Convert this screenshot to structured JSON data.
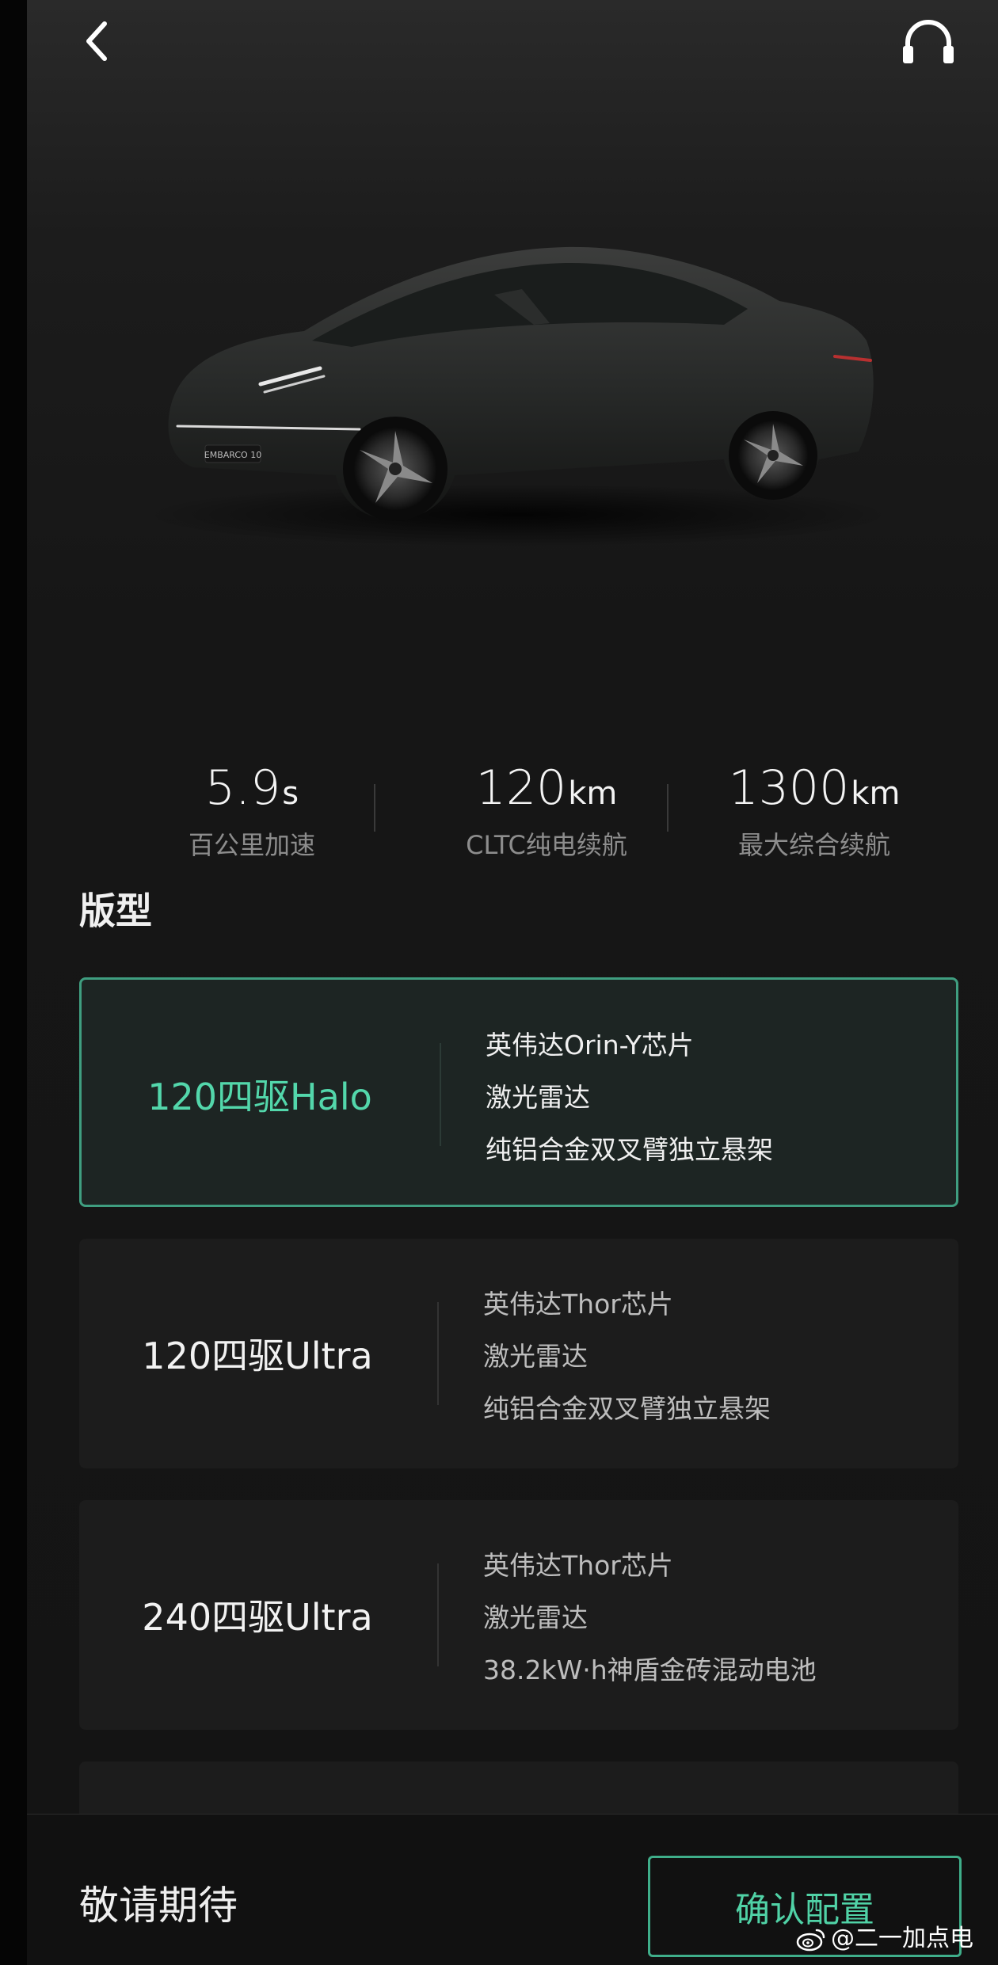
{
  "stats": [
    {
      "value": "5.9",
      "unit": "s",
      "label": "百公里加速"
    },
    {
      "value": "120",
      "unit": "km",
      "label": "CLTC纯电续航"
    },
    {
      "value": "1300",
      "unit": "km",
      "label": "最大综合续航"
    }
  ],
  "section_title": "版型",
  "trims": [
    {
      "name": "120四驱Halo",
      "selected": true,
      "features": [
        "英伟达Orin-Y芯片",
        "激光雷达",
        "纯铝合金双叉臂独立悬架"
      ]
    },
    {
      "name": "120四驱Ultra",
      "selected": false,
      "features": [
        "英伟达Thor芯片",
        "激光雷达",
        "纯铝合金双叉臂独立悬架"
      ]
    },
    {
      "name": "240四驱Ultra",
      "selected": false,
      "features": [
        "英伟达Thor芯片",
        "激光雷达",
        "38.2kW·h神盾金砖混动电池"
      ]
    }
  ],
  "bottom_bar": {
    "status_text": "敬请期待",
    "confirm_label": "确认配置"
  },
  "car_badge": "EMBARCO 10",
  "watermark": "@二一加点电",
  "icons": {
    "back": "back-chevron-icon",
    "support": "headset-icon",
    "weibo": "weibo-icon"
  },
  "colors": {
    "accent": "#53d7ab",
    "background": "#141414",
    "card": "#1c1c1c"
  }
}
